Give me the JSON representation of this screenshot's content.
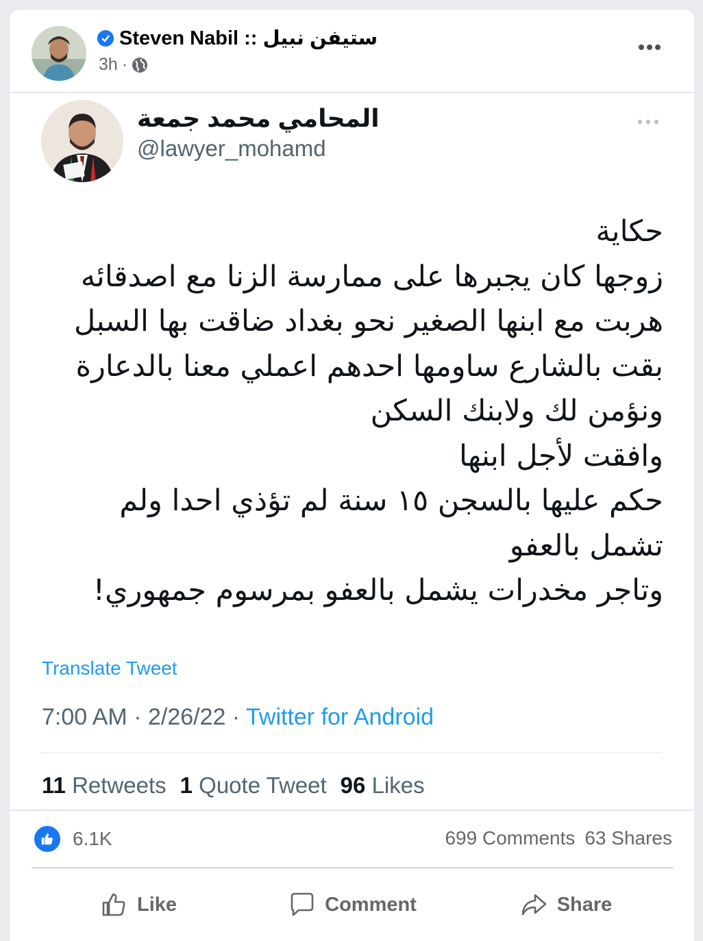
{
  "post": {
    "author": "Steven Nabil :: ستيفن نبيل",
    "time": "3h",
    "separator": "·"
  },
  "tweet": {
    "name": "المحامي محمد جمعة",
    "handle": "@lawyer_mohamd",
    "lines": [
      "حكاية",
      "زوجها كان يجبرها على ممارسة الزنا مع اصدقائه",
      "هربت مع ابنها الصغير نحو بغداد ضاقت بها السبل",
      "بقت بالشارع ساومها احدهم اعملي معنا بالدعارة",
      "ونؤمن لك ولابنك السكن",
      "وافقت لأجل ابنها",
      "حكم عليها بالسجن ١٥ سنة لم تؤذي احدا ولم",
      "تشمل بالعفو",
      "وتاجر مخدرات يشمل بالعفو بمرسوم جمهوري!"
    ],
    "translate_label": "Translate Tweet",
    "time": "7:00 AM · 2/26/22 · ",
    "source": "Twitter for Android",
    "retweets_count": "11",
    "retweets_label": "Retweets",
    "quotes_count": "1",
    "quotes_label": "Quote Tweet",
    "likes_count": "96",
    "likes_label": "Likes"
  },
  "reactions": {
    "count": "6.1K",
    "comments": "699 Comments",
    "shares": "63 Shares"
  },
  "actions": {
    "like": "Like",
    "comment": "Comment",
    "share": "Share"
  },
  "colors": {
    "facebook_blue": "#1877f2",
    "twitter_blue": "#1d9bf0",
    "secondary_text": "#65676b"
  }
}
